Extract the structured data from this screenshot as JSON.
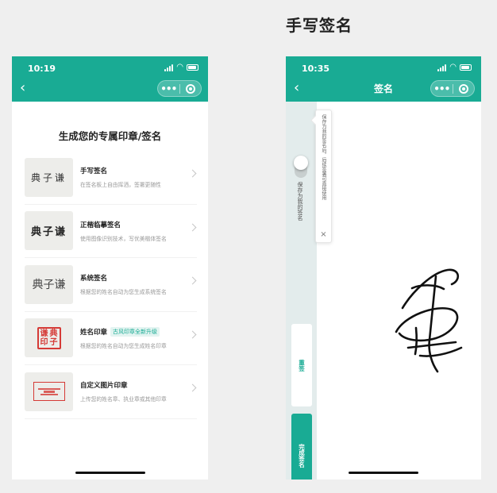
{
  "heading": "手写签名",
  "left_screen": {
    "status_time": "10:19",
    "back_glyph": "‹",
    "capsule_more": "•••",
    "title": "生成您的专属印章/签名",
    "items": [
      {
        "title": "手写签名",
        "desc": "在签名板上自由挥洒，签署更随性",
        "thumb_text": "典子谦"
      },
      {
        "title": "正楷临摹签名",
        "desc": "使用图像识别技术，写优美楷体签名",
        "thumb_text": "典子谦"
      },
      {
        "title": "系统签名",
        "desc": "根据您的姓名自动为您生成系统签名",
        "thumb_text": "典子谦"
      },
      {
        "title": "姓名印章",
        "badge": "古风印章全新升级",
        "desc": "根据您的姓名自动为您生成姓名印章",
        "thumb_text": [
          "谦",
          "典",
          "印",
          "子"
        ]
      },
      {
        "title": "自定义图片印章",
        "desc": "上传您的姓名章、执业章或其他印章"
      }
    ]
  },
  "right_screen": {
    "status_time": "10:35",
    "back_glyph": "‹",
    "capsule_more": "•••",
    "nav_title": "签名",
    "save_label": "保存为我的签名",
    "tooltip_text": "保存为我的签名后，后续签署可直接使用",
    "tooltip_close": "×",
    "reset_label": "重签",
    "done_label": "完成签名"
  },
  "colors": {
    "brand": "#19ab94",
    "seal_red": "#d53a36"
  }
}
